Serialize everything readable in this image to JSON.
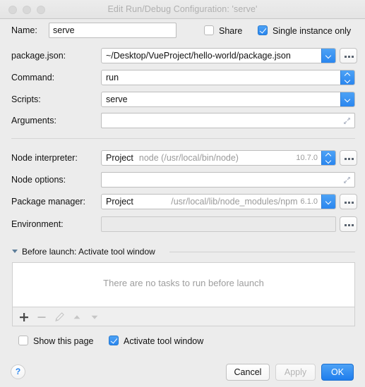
{
  "window": {
    "title": "Edit Run/Debug Configuration: 'serve'",
    "traffic_lights": [
      "close",
      "minimize",
      "maximize"
    ]
  },
  "form": {
    "name": {
      "label": "Name:",
      "value": "serve"
    },
    "share": {
      "label": "Share",
      "checked": false
    },
    "single_instance": {
      "label": "Single instance only",
      "checked": true
    },
    "package_json": {
      "label": "package.json:",
      "value": "~/Desktop/VueProject/hello-world/package.json",
      "browse_label": "..."
    },
    "command": {
      "label": "Command:",
      "value": "run"
    },
    "scripts": {
      "label": "Scripts:",
      "value": "serve"
    },
    "arguments": {
      "label": "Arguments:",
      "value": "",
      "placeholder": ""
    },
    "node_interpreter": {
      "label": "Node interpreter:",
      "tag": "Project",
      "path": "node (/usr/local/bin/node)",
      "version": "10.7.0",
      "browse_label": "..."
    },
    "node_options": {
      "label": "Node options:",
      "value": "",
      "placeholder": ""
    },
    "package_manager": {
      "label": "Package manager:",
      "tag": "Project",
      "path": "/usr/local/lib/node_modules/npm",
      "version": "6.1.0",
      "browse_label": "..."
    },
    "environment": {
      "label": "Environment:",
      "value": "",
      "browse_label": "...",
      "disabled": true
    }
  },
  "before_launch": {
    "title": "Before launch: Activate tool window",
    "expanded": true,
    "empty_text": "There are no tasks to run before launch",
    "toolbar": [
      {
        "name": "add",
        "glyph": "+",
        "enabled": true
      },
      {
        "name": "remove",
        "glyph": "−",
        "enabled": false
      },
      {
        "name": "edit",
        "glyph": "pencil",
        "enabled": false
      },
      {
        "name": "move-up",
        "glyph": "▲",
        "enabled": false
      },
      {
        "name": "move-down",
        "glyph": "▼",
        "enabled": false
      }
    ]
  },
  "options": {
    "show_this_page": {
      "label": "Show this page",
      "checked": false
    },
    "activate_tool_window": {
      "label": "Activate tool window",
      "checked": true
    }
  },
  "footer": {
    "help_label": "?",
    "cancel_label": "Cancel",
    "apply_label": "Apply",
    "apply_enabled": false,
    "ok_label": "OK"
  },
  "colors": {
    "accent": "#2a86ef",
    "background": "#ececec",
    "field_bg": "#ffffff",
    "muted_text": "#9a9a9a",
    "title_text": "#b0b0b0"
  }
}
